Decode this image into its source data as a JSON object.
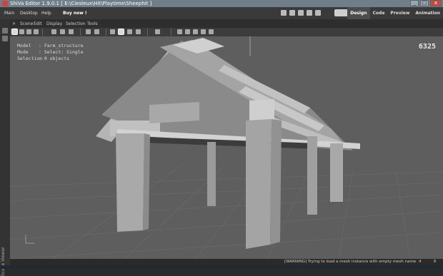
{
  "titlebar": {
    "title": "ShiVa Editor 1.9.0.1 [ E:\\Ciesleux\\Hit\\Playtime\\Sheephit ]",
    "minimize": "_",
    "maximize": "□",
    "close": "x"
  },
  "menubar": {
    "items": [
      "Main",
      "Desktop",
      "Help"
    ],
    "buy": "Buy now !",
    "modes": [
      "Design",
      "Code",
      "Preview",
      "Animation"
    ],
    "active_mode": "Design"
  },
  "panel": {
    "tabs": [
      "Scene",
      "Edit",
      "Display",
      "Selection",
      "Tools"
    ],
    "side_label": "Scene Viewer"
  },
  "hud": {
    "model_label": "Model",
    "model_value": "Farm_structure",
    "mode_label": "Mode",
    "mode_value": "Select: Single",
    "selection_label": "Selection",
    "selection_value": "0 objects",
    "fps": "6325"
  },
  "statusbar": {
    "message": "[WARNING] Trying to load a mesh instance with empty mesh name",
    "count1": "4",
    "count2": "6"
  },
  "colors": {
    "viewport_bg": "#5e5e5e",
    "mesh_light": "#c9c9c9",
    "mesh_mid": "#9d9d9d",
    "mesh_dark": "#6a6a6a",
    "active_mode_bg": "#4c4c4c"
  },
  "icons": [
    "select-arrow-icon",
    "move-icon",
    "rotate-icon",
    "scale-icon",
    "camera-icon",
    "brush-icon",
    "paint-icon",
    "grid-icon",
    "light-icon",
    "refresh-icon",
    "render-icon"
  ]
}
